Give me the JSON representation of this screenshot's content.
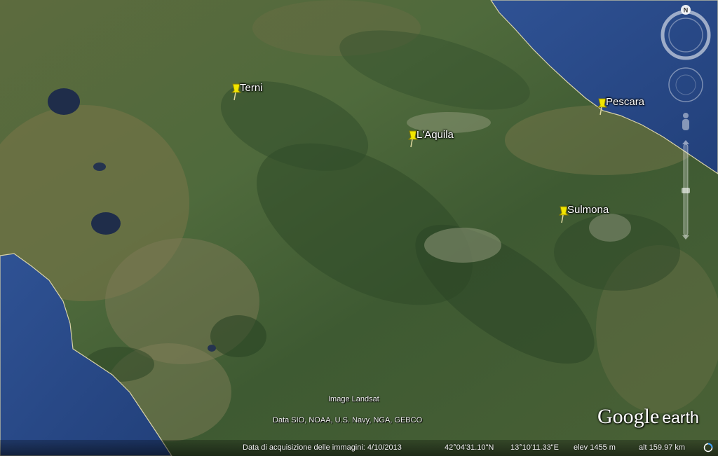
{
  "map": {
    "places": [
      {
        "label": "Terni"
      },
      {
        "label": "L'Aquila"
      },
      {
        "label": "Pescara"
      },
      {
        "label": "Sulmona"
      }
    ],
    "colors": {
      "pin": "#f2e600",
      "sea": "#2a4a86",
      "land": "#48633a"
    }
  },
  "credits": {
    "image": "Image Landsat",
    "data": "Data SIO, NOAA, U.S. Navy, NGA, GEBCO"
  },
  "logo": {
    "google": "Google",
    "earth": "earth"
  },
  "status_bar": {
    "date": "Data di acquisizione delle immagini: 4/10/2013",
    "lat": "42°04'31.10\"N",
    "lon": "13°10'11.33\"E",
    "elev": "elev  1455 m",
    "alt": "alt 159.97 km"
  },
  "navigation": {
    "north_label": "N",
    "icons": [
      "compass-ring-icon",
      "look-joystick-icon",
      "street-view-person-icon",
      "zoom-slider-icon"
    ]
  }
}
